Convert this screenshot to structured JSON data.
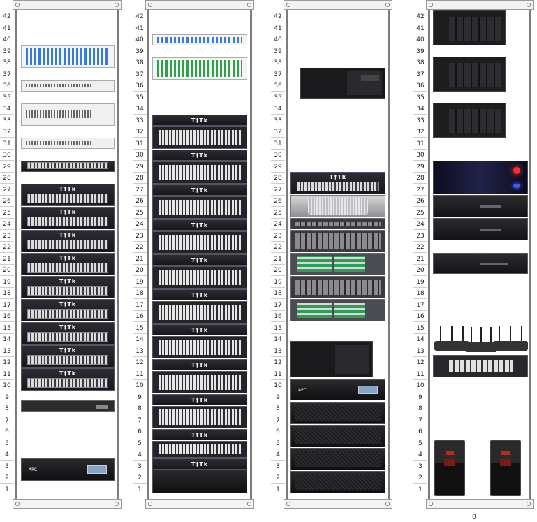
{
  "unit_labels": [
    "42",
    "41",
    "40",
    "39",
    "38",
    "37",
    "36",
    "35",
    "34",
    "33",
    "32",
    "31",
    "30",
    "29",
    "28",
    "27",
    "26",
    "25",
    "24",
    "23",
    "22",
    "21",
    "20",
    "19",
    "18",
    "17",
    "16",
    "15",
    "14",
    "13",
    "12",
    "11",
    "10",
    "9",
    "8",
    "7",
    "6",
    "5",
    "4",
    "3",
    "2",
    "1"
  ],
  "switch_logo": "T†Tk",
  "ups_brand": "APC",
  "page_number": "0"
}
